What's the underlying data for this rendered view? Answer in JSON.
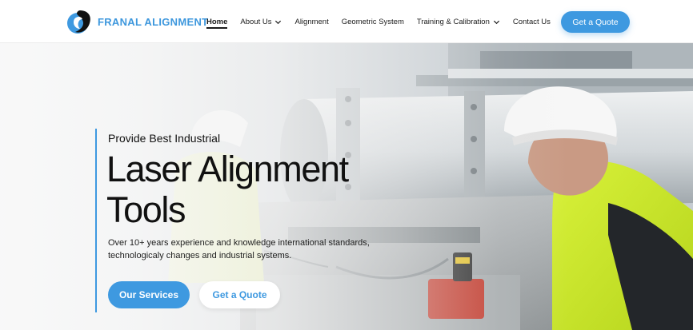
{
  "brand": {
    "name": "FRANAL ALIGNMENT",
    "primary_color": "#3e99e0"
  },
  "nav": {
    "items": [
      {
        "label": "Home",
        "active": true,
        "has_dropdown": false
      },
      {
        "label": "About Us",
        "active": false,
        "has_dropdown": true
      },
      {
        "label": "Alignment",
        "active": false,
        "has_dropdown": false
      },
      {
        "label": "Geometric System",
        "active": false,
        "has_dropdown": false
      },
      {
        "label": "Training & Calibration",
        "active": false,
        "has_dropdown": true
      },
      {
        "label": "Contact Us",
        "active": false,
        "has_dropdown": false
      }
    ],
    "cta_label": "Get a Quote"
  },
  "hero": {
    "eyebrow": "Provide Best Industrial",
    "headline": "Laser Alignment Tools",
    "description": "Over 10+ years experience and knowledge international standards, technologicaly changes and industrial systems.",
    "primary_button": "Our Services",
    "secondary_button": "Get a Quote",
    "image_subject": "technician in hard hat and hi-vis vest operating laser alignment tool on industrial pipework"
  },
  "icons": [
    "logo-mark-icon",
    "chevron-down-icon"
  ]
}
